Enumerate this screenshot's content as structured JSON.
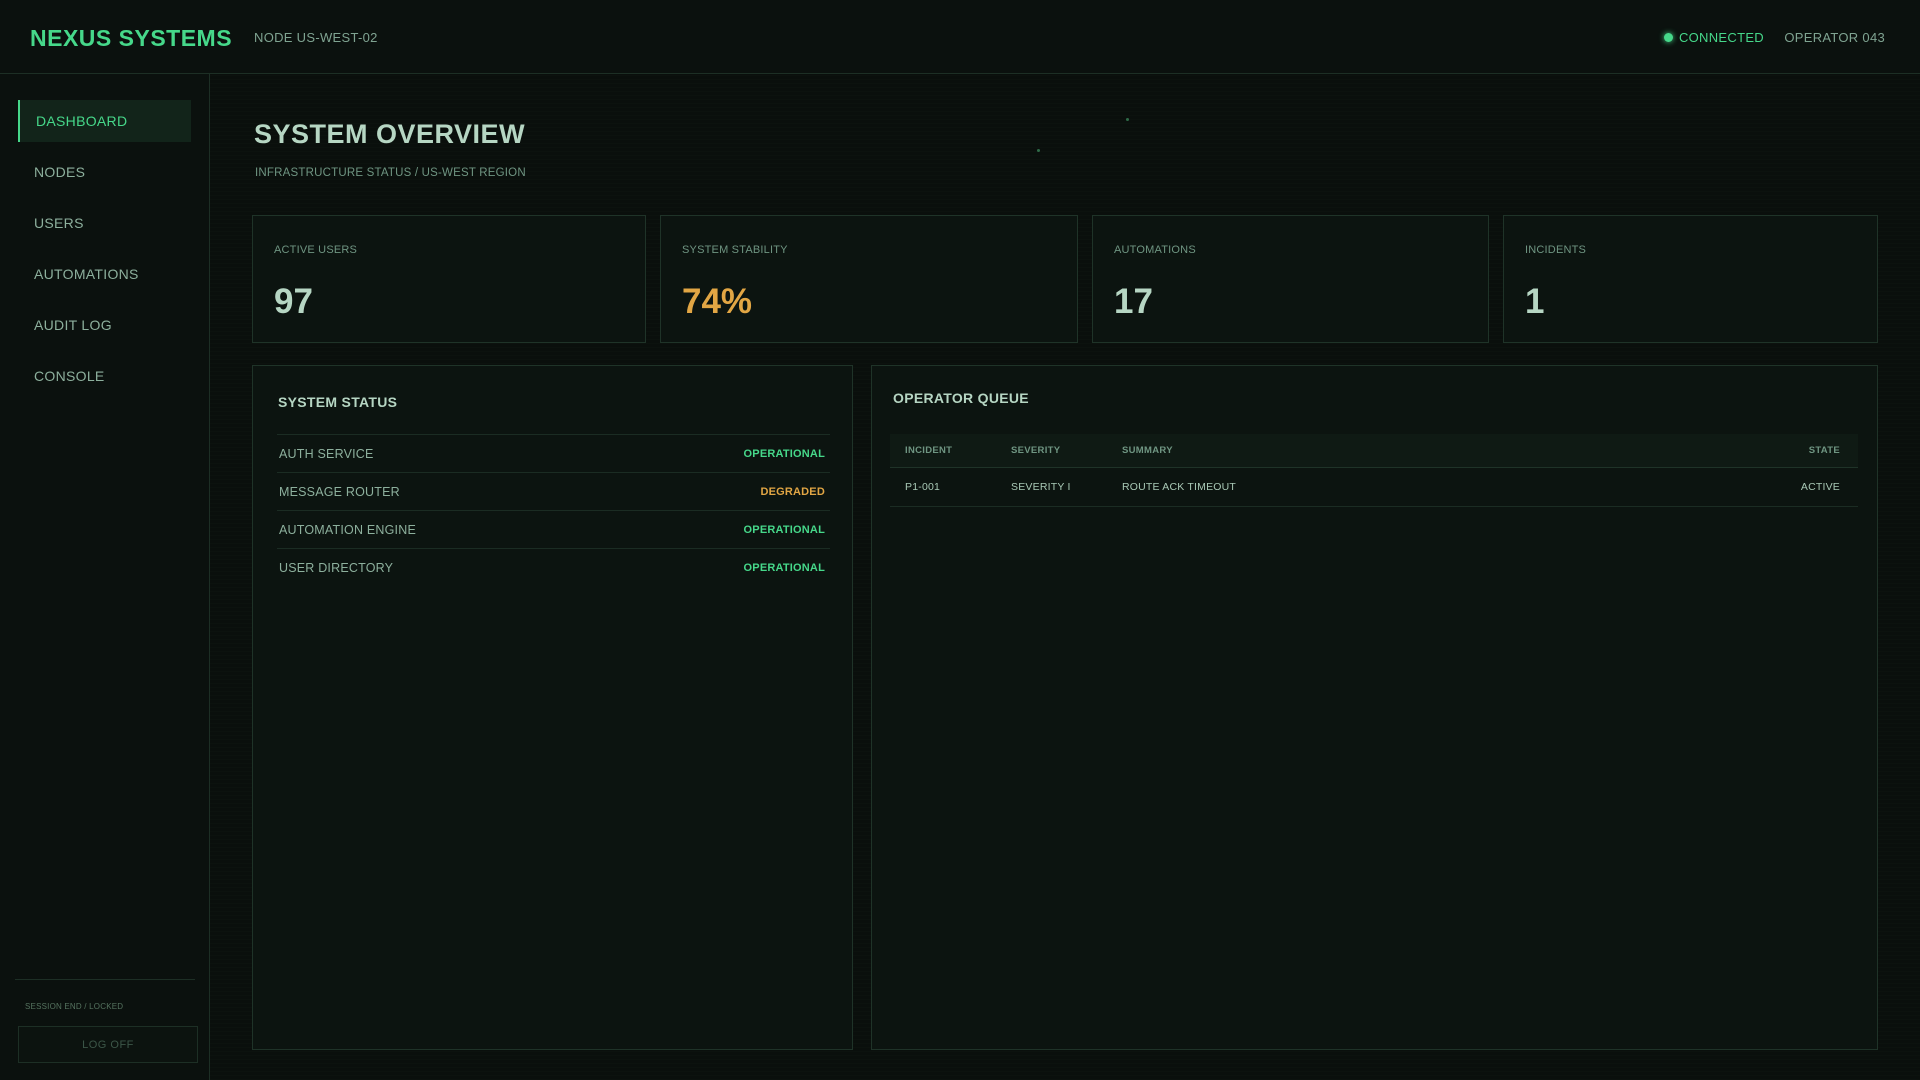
{
  "header": {
    "brand": "NEXUS SYSTEMS",
    "node": "NODE US-WEST-02",
    "connection_status": "CONNECTED",
    "operator": "OPERATOR 043"
  },
  "sidebar": {
    "items": [
      {
        "label": "DASHBOARD",
        "active": true
      },
      {
        "label": "NODES",
        "active": false
      },
      {
        "label": "USERS",
        "active": false
      },
      {
        "label": "AUTOMATIONS",
        "active": false
      },
      {
        "label": "AUDIT LOG",
        "active": false
      },
      {
        "label": "CONSOLE",
        "active": false
      }
    ],
    "session_text": "SESSION END / LOCKED",
    "logoff_label": "LOG OFF"
  },
  "main": {
    "title": "SYSTEM OVERVIEW",
    "subtitle": "INFRASTRUCTURE STATUS / US-WEST REGION",
    "stats": [
      {
        "label": "ACTIVE USERS",
        "value": "97"
      },
      {
        "label": "SYSTEM STABILITY",
        "value": "74%"
      },
      {
        "label": "AUTOMATIONS",
        "value": "17"
      },
      {
        "label": "INCIDENTS",
        "value": "1"
      }
    ],
    "system_status": {
      "title": "SYSTEM STATUS",
      "rows": [
        {
          "name": "AUTH SERVICE",
          "status": "OPERATIONAL"
        },
        {
          "name": "MESSAGE ROUTER",
          "status": "DEGRADED"
        },
        {
          "name": "AUTOMATION ENGINE",
          "status": "OPERATIONAL"
        },
        {
          "name": "USER DIRECTORY",
          "status": "OPERATIONAL"
        }
      ]
    },
    "operator_queue": {
      "title": "OPERATOR QUEUE",
      "columns": [
        "INCIDENT",
        "SEVERITY",
        "SUMMARY",
        "STATE"
      ],
      "rows": [
        {
          "incident": "P1-001",
          "severity": "SEVERITY I",
          "summary": "ROUTE ACK TIMEOUT",
          "state": "ACTIVE"
        }
      ]
    }
  },
  "colors": {
    "accent": "#46d88a",
    "warning": "#e2a644",
    "background": "#0a0f0c",
    "panel": "#0c1410",
    "border": "#1f3328"
  }
}
